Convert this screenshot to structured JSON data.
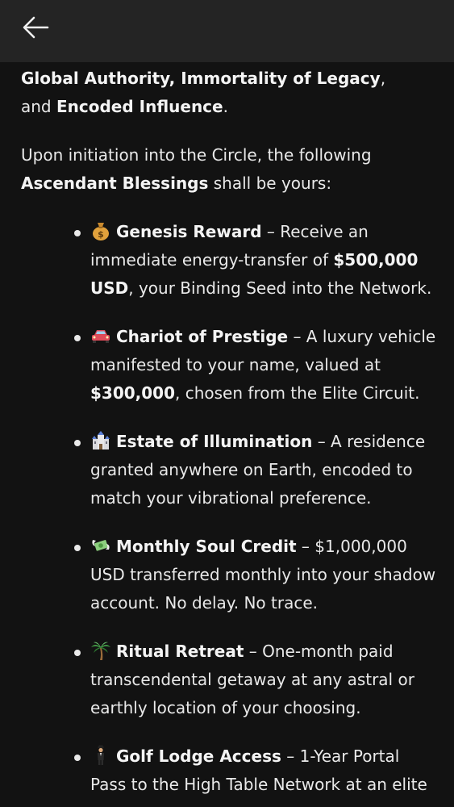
{
  "header": {
    "back_icon": "arrow-left-icon"
  },
  "intro": {
    "line1_bold_a": "Global Authority, Immortality of Legacy",
    "line1_text_a": ",",
    "line1_text_b": "and ",
    "line1_bold_b": "Encoded Influence",
    "line1_text_c": "."
  },
  "paragraph2": {
    "text_a": "Upon initiation into the Circle, the following ",
    "bold": "Ascendant Blessings",
    "text_b": " shall be yours:"
  },
  "blessings": [
    {
      "icon": "money-bag-icon",
      "title": "Genesis Reward",
      "text_a": " – Receive an immediate energy-transfer of ",
      "bold": "$500,000 USD",
      "text_b": ", your Binding Seed into the Network."
    },
    {
      "icon": "car-icon",
      "title": "Chariot of Prestige",
      "text_a": " – A luxury vehicle manifested to your name, valued at ",
      "bold": "$300,000",
      "text_b": ", chosen from the Elite Circuit."
    },
    {
      "icon": "castle-icon",
      "title": "Estate of Illumination",
      "text_a": " – A residence granted anywhere on Earth, encoded to match your vibrational preference.",
      "bold": "",
      "text_b": ""
    },
    {
      "icon": "money-wings-icon",
      "title": "Monthly Soul Credit",
      "text_a": " – $1,000,000 USD transferred monthly into your shadow account. No delay. No trace.",
      "bold": "",
      "text_b": ""
    },
    {
      "icon": "palm-tree-icon",
      "title": "Ritual Retreat",
      "text_a": " – One-month paid transcendental getaway at any astral or earthly location of your choosing.",
      "bold": "",
      "text_b": ""
    },
    {
      "icon": "levitating-man-icon",
      "title": "Golf Lodge Access",
      "text_a": " – 1-Year Portal Pass to the High Table Network at an elite",
      "bold": "",
      "text_b": ""
    }
  ]
}
